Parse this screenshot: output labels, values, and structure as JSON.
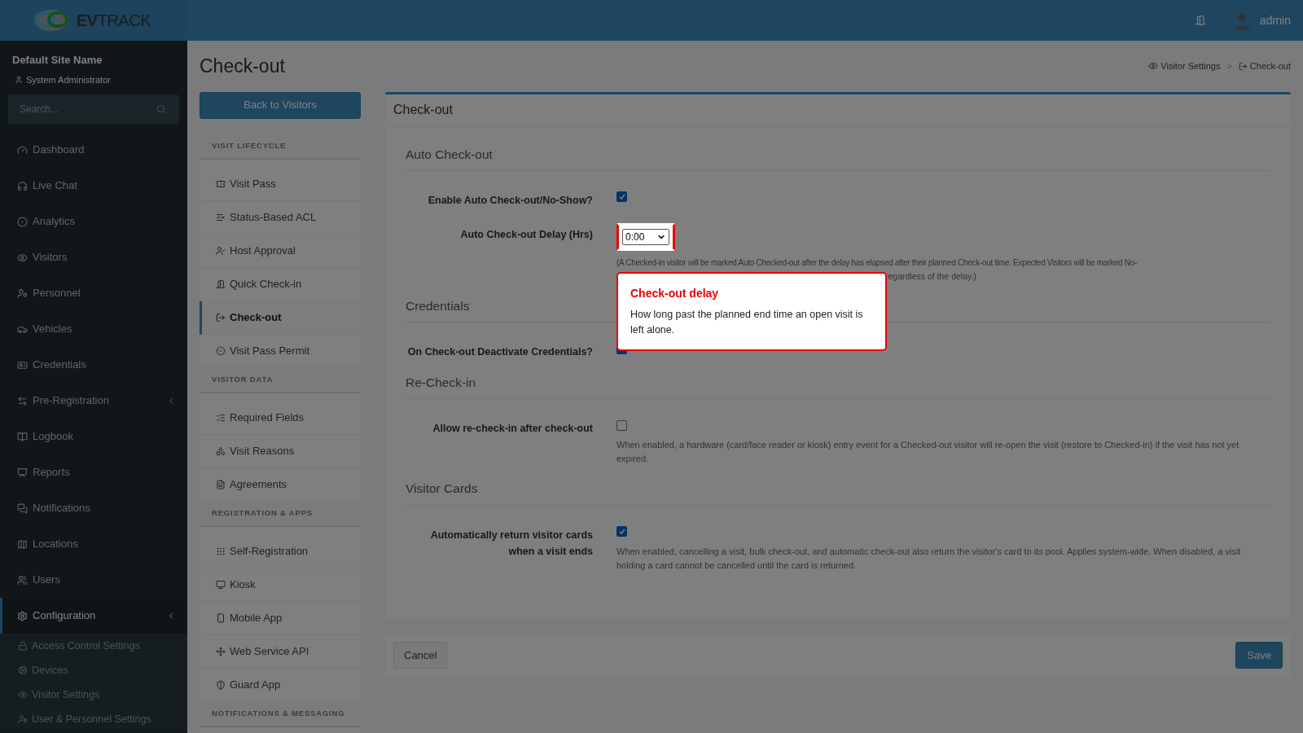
{
  "header": {
    "logo_text": "**EV**TRACK",
    "user": "admin"
  },
  "sidebar": {
    "site_name": "Default Site Name",
    "role": "System Administrator",
    "search": {
      "placeholder": "Search..."
    },
    "items": [
      {
        "label": "Dashboard",
        "has_submenu": false,
        "selected": false
      },
      {
        "label": "Live Chat",
        "has_submenu": false,
        "selected": false
      },
      {
        "label": "Analytics",
        "has_submenu": false,
        "selected": false
      },
      {
        "label": "Visitors",
        "has_submenu": false,
        "selected": false
      },
      {
        "label": "Personnel",
        "has_submenu": false,
        "selected": false
      },
      {
        "label": "Vehicles",
        "has_submenu": false,
        "selected": false
      },
      {
        "label": "Credentials",
        "has_submenu": false,
        "selected": false
      },
      {
        "label": "Pre-Registration",
        "has_submenu": true,
        "selected": false
      },
      {
        "label": "Logbook",
        "has_submenu": false,
        "selected": false
      },
      {
        "label": "Reports",
        "has_submenu": false,
        "selected": false
      },
      {
        "label": "Notifications",
        "has_submenu": false,
        "selected": false
      },
      {
        "label": "Locations",
        "has_submenu": false,
        "selected": false
      },
      {
        "label": "Users",
        "has_submenu": false,
        "selected": false
      },
      {
        "label": "Configuration",
        "has_submenu": true,
        "selected": true,
        "children": [
          {
            "label": "Access Control Settings"
          },
          {
            "label": "Devices"
          },
          {
            "label": "Visitor Settings"
          },
          {
            "label": "User & Personnel Settings"
          }
        ]
      }
    ]
  },
  "page": {
    "title": "Check-out",
    "breadcrumb": [
      "Visitor Settings",
      "Check-out"
    ],
    "breadcrumb_separator": ">",
    "back_button": "Back to Visitors"
  },
  "settings_nav": [
    {
      "heading": "VISIT LIFECYCLE",
      "items": [
        {
          "label": "Visit Pass",
          "selected": false
        },
        {
          "label": "Status-Based ACL",
          "selected": false
        },
        {
          "label": "Host Approval",
          "selected": false
        },
        {
          "label": "Quick Check-in",
          "selected": false
        },
        {
          "label": "Check-out",
          "selected": true
        },
        {
          "label": "Visit Pass Permit",
          "selected": false
        }
      ]
    },
    {
      "heading": "VISITOR DATA",
      "items": [
        {
          "label": "Required Fields",
          "selected": false
        },
        {
          "label": "Visit Reasons",
          "selected": false
        },
        {
          "label": "Agreements",
          "selected": false
        }
      ]
    },
    {
      "heading": "REGISTRATION & APPS",
      "items": [
        {
          "label": "Self-Registration",
          "selected": false
        },
        {
          "label": "Kiosk",
          "selected": false
        },
        {
          "label": "Mobile App",
          "selected": false
        },
        {
          "label": "Web Service API",
          "selected": false
        },
        {
          "label": "Guard App",
          "selected": false
        }
      ]
    },
    {
      "heading": "NOTIFICATIONS & MESSAGING"
    }
  ],
  "card": {
    "title": "Check-out",
    "sections": [
      {
        "title": "Auto Check-out",
        "fields": [
          {
            "kind": "checkbox",
            "label": "Enable Auto Check-out/No-Show?",
            "checked": true
          },
          {
            "kind": "select",
            "label": "Auto Check-out Delay (Hrs)",
            "value": "0:00",
            "help": "(A Checked-in visitor will be marked Auto Checked-out after the delay has elapsed after their planned Check-out time. Expected Visitors will be marked No-",
            "help_tail": "regardless of the delay.)"
          }
        ]
      },
      {
        "title": "Credentials",
        "fields": [
          {
            "kind": "checkbox",
            "label": "On Check-out Deactivate Credentials?",
            "checked": true
          }
        ]
      },
      {
        "title": "Re-Check-in",
        "fields": [
          {
            "kind": "checkbox",
            "label": "Allow re-check-in after check-out",
            "checked": false,
            "help": "When enabled, a hardware (card/face reader or kiosk) entry event for a Checked-out visitor will re-open the visit (restore to Checked-in) if the visit has not yet expired."
          }
        ]
      },
      {
        "title": "Visitor Cards",
        "fields": [
          {
            "kind": "checkbox",
            "label": "Automatically return visitor cards when a visit ends",
            "checked": true,
            "help": "When enabled, cancelling a visit, bulk check-out, and automatic check-out also return the visitor's card to its pool. Applies system-wide. When disabled, a visit holding a card cannot be cancelled until the card is returned."
          }
        ]
      }
    ],
    "cancel_button": "Cancel",
    "save_button": "Save"
  },
  "tooltip": {
    "title": "Check-out delay",
    "body": "How long past the planned end time an open visit is left alone."
  }
}
